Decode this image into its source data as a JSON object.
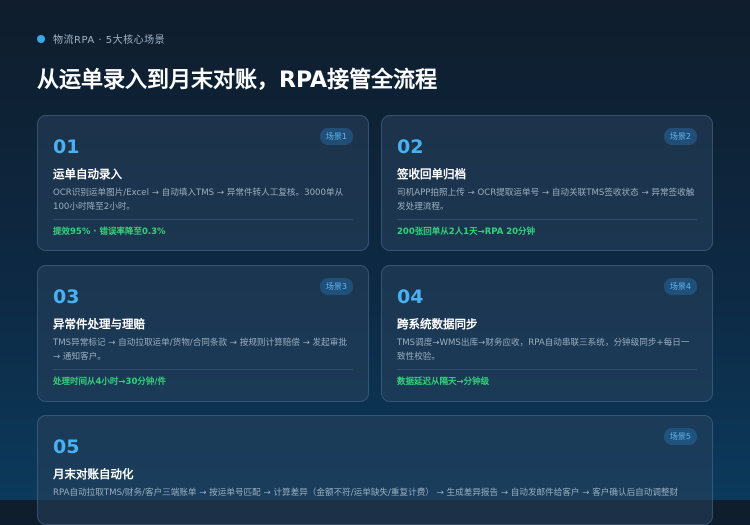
{
  "header": {
    "eyebrow": "物流RPA · 5大核心场景",
    "title": "从运单录入到月末对账，RPA接管全流程"
  },
  "colors": {
    "accent": "#49b1f1",
    "metric": "#35d17a",
    "background": "#0d2a45"
  },
  "cards": [
    {
      "badge": "场景1",
      "number": "01",
      "title": "运单自动录入",
      "desc": "OCR识别运单图片/Excel → 自动填入TMS → 异常件转人工复核。3000单从100小时降至2小时。",
      "metric": "提效95% · 错误率降至0.3%"
    },
    {
      "badge": "场景2",
      "number": "02",
      "title": "签收回单归档",
      "desc": "司机APP拍照上传 → OCR提取运单号 → 自动关联TMS签收状态 → 异常签收触发处理流程。",
      "metric": "200张回单从2人1天→RPA 20分钟"
    },
    {
      "badge": "场景3",
      "number": "03",
      "title": "异常件处理与理赔",
      "desc": "TMS异常标记 → 自动拉取运单/货物/合同条款 → 按规则计算赔偿 → 发起审批 → 通知客户。",
      "metric": "处理时间从4小时→30分钟/件"
    },
    {
      "badge": "场景4",
      "number": "04",
      "title": "跨系统数据同步",
      "desc": "TMS调度→WMS出库→财务应收，RPA自动串联三系统，分钟级同步+每日一致性校验。",
      "metric": "数据延迟从隔天→分钟级"
    },
    {
      "badge": "场景5",
      "number": "05",
      "title": "月末对账自动化",
      "desc": "RPA自动拉取TMS/财务/客户三端账单 → 按运单号匹配 → 计算差异（金额不符/运单缺失/重复计费） → 生成差异报告 → 自动发邮件给客户 → 客户确认后自动调整财",
      "metric": ""
    }
  ]
}
